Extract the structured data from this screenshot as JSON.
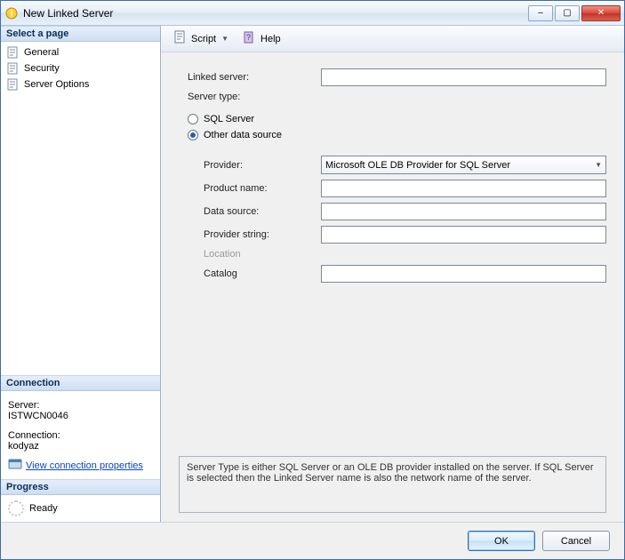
{
  "window": {
    "title": "New Linked Server"
  },
  "titlebar_buttons": {
    "minimize": "–",
    "maximize": "▢",
    "close": "✕"
  },
  "sidebar": {
    "select_page_header": "Select a page",
    "items": [
      {
        "label": "General"
      },
      {
        "label": "Security"
      },
      {
        "label": "Server Options"
      }
    ],
    "connection_header": "Connection",
    "server_label": "Server:",
    "server_value": "ISTWCN0046",
    "connection_label": "Connection:",
    "connection_value": "kodyaz",
    "view_props": "View connection properties",
    "progress_header": "Progress",
    "progress_status": "Ready"
  },
  "toolbar": {
    "script": "Script",
    "help": "Help"
  },
  "form": {
    "linked_server_label": "Linked server:",
    "linked_server_value": "",
    "server_type_label": "Server type:",
    "radio_sql": "SQL Server",
    "radio_other": "Other data source",
    "radio_selected": "other",
    "provider_label": "Provider:",
    "provider_value": "Microsoft OLE DB Provider for SQL Server",
    "product_name_label": "Product name:",
    "product_name_value": "",
    "data_source_label": "Data source:",
    "data_source_value": "",
    "provider_string_label": "Provider string:",
    "provider_string_value": "",
    "location_label": "Location",
    "catalog_label": "Catalog",
    "catalog_value": "",
    "description": "Server Type is either SQL Server or an OLE DB provider installed on the server. If SQL Server is selected then the Linked Server name is also the network name of the server."
  },
  "buttons": {
    "ok": "OK",
    "cancel": "Cancel"
  }
}
